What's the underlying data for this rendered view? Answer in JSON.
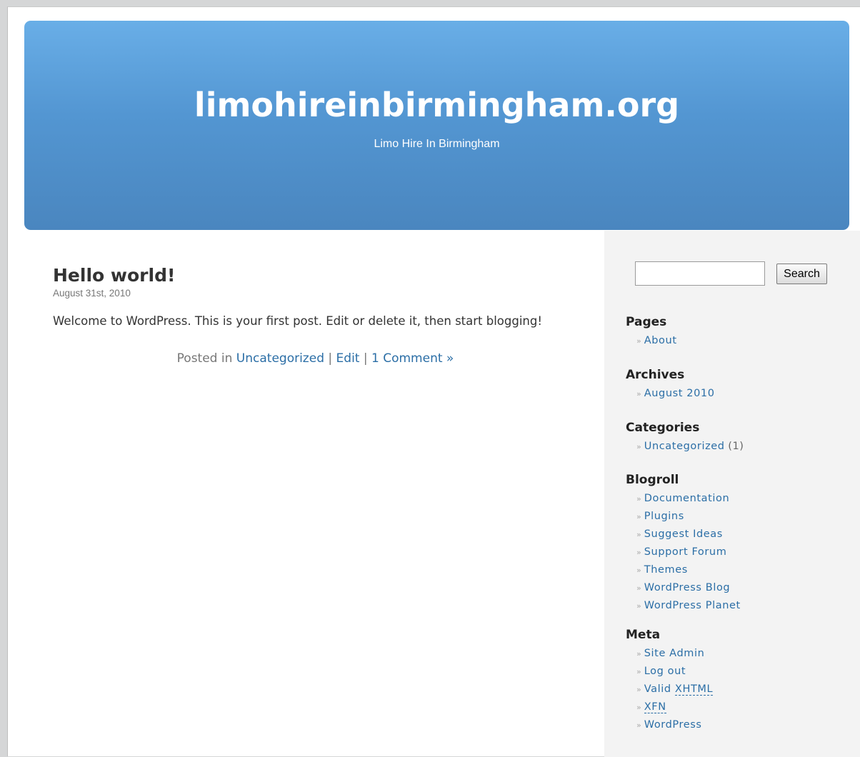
{
  "header": {
    "blog_title": "limohireinbirmingham.org",
    "blog_description": "Limo Hire In Birmingham"
  },
  "colors": {
    "header_gradient_top": "#69aee7",
    "header_gradient_bottom": "#4a86bf",
    "link": "#2b6ea6",
    "sidebar_background": "#f3f3f3"
  },
  "post": {
    "title": "Hello world!",
    "date": "August 31st, 2010",
    "body": "Welcome to WordPress. This is your first post. Edit or delete it, then start blogging!",
    "meta": {
      "posted_in_prefix": "Posted in",
      "category": "Uncategorized",
      "separator": "|",
      "edit": "Edit",
      "comments": "1 Comment »"
    }
  },
  "sidebar": {
    "search": {
      "value": "",
      "button_label": "Search"
    },
    "bullet": "»",
    "pages": {
      "title": "Pages",
      "items": [
        "About"
      ]
    },
    "archives": {
      "title": "Archives",
      "items": [
        "August 2010"
      ]
    },
    "categories": {
      "title": "Categories",
      "items": [
        {
          "label": "Uncategorized",
          "count": "(1)"
        }
      ]
    },
    "blogroll": {
      "title": "Blogroll",
      "items": [
        "Documentation",
        "Plugins",
        "Suggest Ideas",
        "Support Forum",
        "Themes",
        "WordPress Blog",
        "WordPress Planet"
      ]
    },
    "meta": {
      "title": "Meta",
      "items": [
        "Site Admin",
        "Log out",
        "Valid",
        "XHTML",
        "XFN",
        "WordPress"
      ]
    }
  }
}
